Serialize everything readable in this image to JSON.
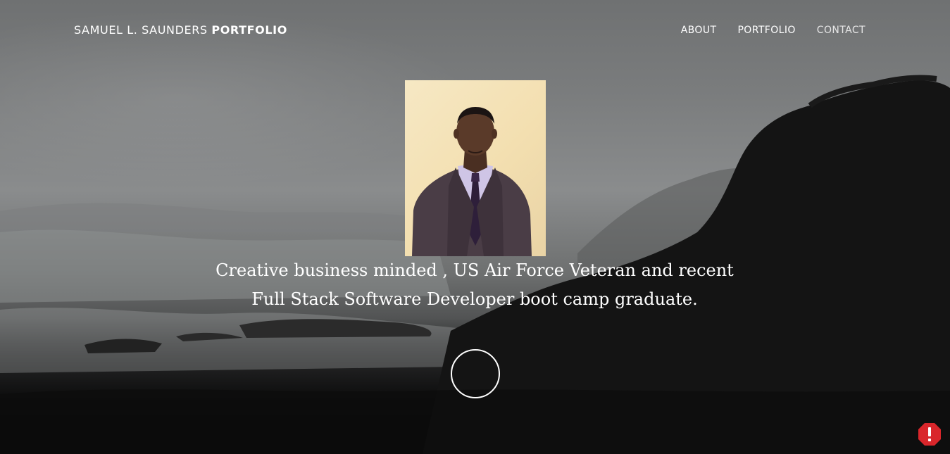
{
  "navbar": {
    "brand_name": "SAMUEL L. SAUNDERS",
    "brand_strong": "PORTFOLIO",
    "links": [
      {
        "label": "ABOUT"
      },
      {
        "label": "PORTFOLIO"
      },
      {
        "label": "CONTACT"
      }
    ]
  },
  "hero": {
    "tagline_line1": "Creative business minded , US Air Force Veteran and recent",
    "tagline_line2": "Full Stack Software Developer boot camp graduate."
  },
  "icons": {
    "scroll": "circle-outline-icon",
    "alert": "error-badge-icon"
  },
  "colors": {
    "text": "#ffffff",
    "alert": "#d9262b"
  }
}
